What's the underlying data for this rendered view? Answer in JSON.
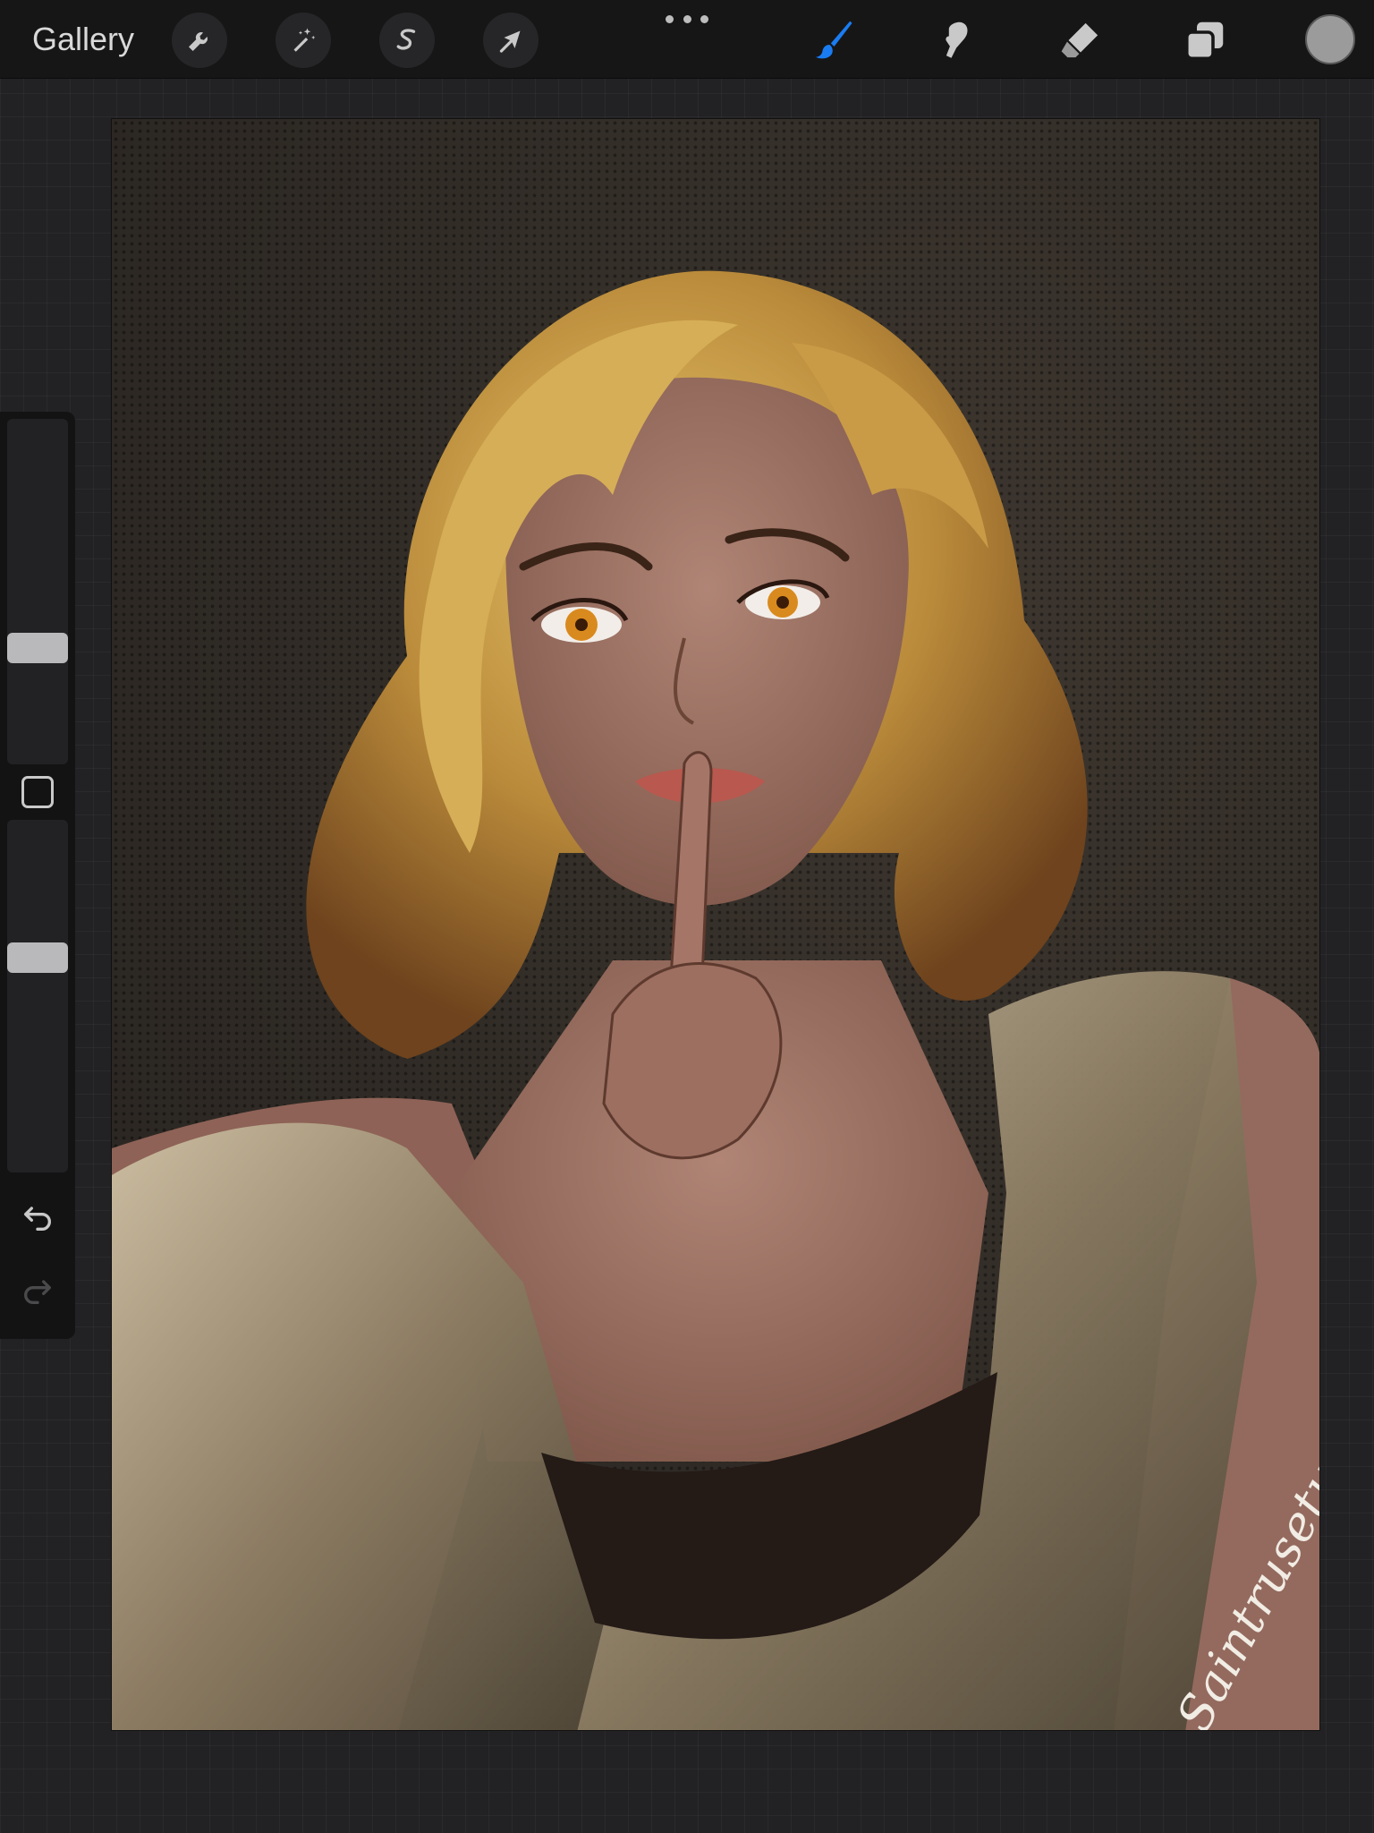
{
  "topbar": {
    "gallery_label": "Gallery",
    "left_tools": [
      {
        "name": "actions",
        "icon": "wrench-icon"
      },
      {
        "name": "adjustments",
        "icon": "magic-wand-icon"
      },
      {
        "name": "selection",
        "icon": "selection-s-icon"
      },
      {
        "name": "transform",
        "icon": "arrow-cursor-icon"
      }
    ],
    "right_tools": [
      {
        "name": "brush",
        "icon": "brush-icon",
        "active": true
      },
      {
        "name": "smudge",
        "icon": "smudge-finger-icon",
        "active": false
      },
      {
        "name": "eraser",
        "icon": "eraser-icon",
        "active": false
      },
      {
        "name": "layers",
        "icon": "layers-icon",
        "active": false
      }
    ],
    "current_color": "#9b9b9b",
    "accent_color": "#1a7cf2"
  },
  "sidebar": {
    "brush_size_level": 0.32,
    "opacity_level": 0.62,
    "undo_icon": "undo-icon",
    "redo_icon": "redo-icon"
  },
  "canvas": {
    "artwork": "portrait painting",
    "signature": "Saintrusetu"
  }
}
